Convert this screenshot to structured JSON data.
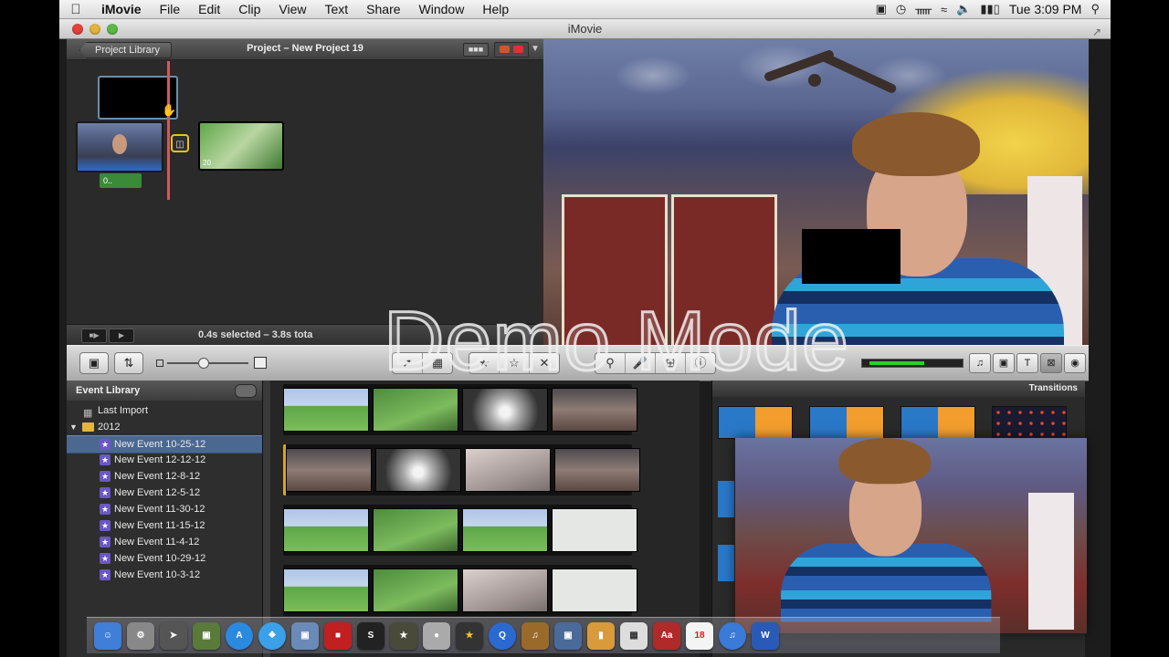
{
  "menubar": {
    "apple_icon": "apple-logo",
    "app_name": "iMovie",
    "items": [
      "File",
      "Edit",
      "Clip",
      "View",
      "Text",
      "Share",
      "Window",
      "Help"
    ],
    "clock": "Tue 3:09 PM",
    "status_icons": [
      "camera-icon",
      "time-machine-icon",
      "bluetooth-icon",
      "wifi-icon",
      "volume-icon",
      "battery-icon",
      "spotlight-icon"
    ]
  },
  "window": {
    "title": "iMovie"
  },
  "project": {
    "back_button": "Project Library",
    "title": "Project – New Project 19",
    "clip_duration": "20",
    "title_badge": "0..",
    "selection_info": "0.4s selected – 3.8s tota"
  },
  "watermark": {
    "text": "Demo Mode"
  },
  "event_library": {
    "header": "Event Library",
    "last_import": "Last Import",
    "year_folder": "2012",
    "events": [
      "New Event 10-25-12",
      "New Event 12-12-12",
      "New Event 12-8-12",
      "New Event 12-5-12",
      "New Event 11-30-12",
      "New Event 11-15-12",
      "New Event 11-4-12",
      "New Event 10-29-12",
      "New Event 10-3-12"
    ],
    "selected_index": 0
  },
  "transitions": {
    "header": "Transitions"
  },
  "dock": {
    "icons": [
      "finder",
      "system-preferences",
      "launchpad",
      "photo-booth",
      "app-store",
      "safari",
      "preview",
      "photoshop",
      "slender",
      "call-of-duty",
      "disk-utility",
      "imovie",
      "quicktime",
      "garageband",
      "iphoto",
      "ibooks",
      "calculator",
      "dictionary",
      "calendar",
      "itunes",
      "word"
    ],
    "calendar_day": "18",
    "dictionary_label": "Aa"
  },
  "colors": {
    "selection": "#4b6891",
    "playhead": "#d05a5a",
    "transition_border": "#e7c21e",
    "event_star": "#6b57c6",
    "folder": "#e5b43c"
  }
}
